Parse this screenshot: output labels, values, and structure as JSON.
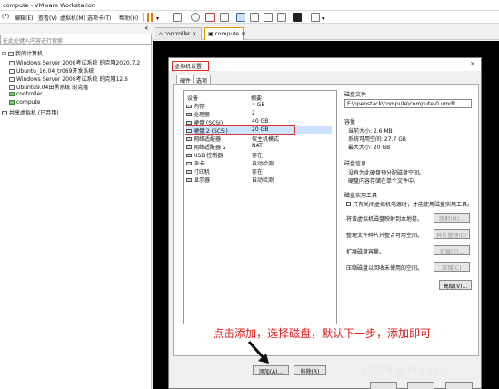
{
  "window": {
    "title": "compute - VMware Workstation"
  },
  "menu": [
    {
      "label": "(F)"
    },
    {
      "label": "编辑(E)"
    },
    {
      "label": "查看(V)"
    },
    {
      "label": "虚拟机(M)"
    },
    {
      "label": "选项卡(T)"
    },
    {
      "label": "帮助(H)"
    }
  ],
  "library": {
    "search_placeholder": "在此处键入内容进行搜索",
    "root": "我的计算机",
    "items": [
      {
        "label": "Windows Server 2008考试系统 的克隆2020.7.2"
      },
      {
        "label": "Ubuntu_16.04_tr069开发系统"
      },
      {
        "label": "Windows Server 2008考试系统 的克隆12.6"
      },
      {
        "label": "Ubuntu9.04田黑系统 的克隆"
      },
      {
        "label": "controller"
      },
      {
        "label": "compute"
      }
    ],
    "shared": "共享虚拟机 (已弃用)"
  },
  "tabs": [
    {
      "label": "controller"
    },
    {
      "label": "compute"
    }
  ],
  "dialog": {
    "title": "虚拟机设置",
    "tabs": [
      {
        "label": "硬件"
      },
      {
        "label": "选项"
      }
    ],
    "devlist_headers": {
      "device": "设备",
      "summary": "摘要"
    },
    "devices": [
      {
        "name": "内存",
        "summary": "4 GB"
      },
      {
        "name": "处理器",
        "summary": "2"
      },
      {
        "name": "硬盘 (SCSI)",
        "summary": "40 GB"
      },
      {
        "name": "硬盘 2 (SCSI)",
        "summary": "20 GB"
      },
      {
        "name": "网络适配器",
        "summary": "仅主机模式"
      },
      {
        "name": "网络适配器 2",
        "summary": "NAT"
      },
      {
        "name": "USB 控制器",
        "summary": "存在"
      },
      {
        "name": "声卡",
        "summary": "自动检测"
      },
      {
        "name": "打印机",
        "summary": "存在"
      },
      {
        "name": "显示器",
        "summary": "自动检测"
      }
    ],
    "add_button": "添加(A)...",
    "remove_button": "移除(R)",
    "disk_file": {
      "heading": "磁盘文件",
      "path": "F:\\openstack\\compute\\compute-0.vmdk"
    },
    "capacity": {
      "heading": "容量",
      "current_label": "当前大小: 2.6 MB",
      "free_label": "系统可用空间: 27.7 GB",
      "max_label": "最大大小: 20 GB"
    },
    "disk_info": {
      "heading": "磁盘信息",
      "line1": "没有为此硬盘预分配磁盘空间。",
      "line2": "硬盘内容存储在单个文件中。"
    },
    "disk_utility": {
      "heading": "磁盘实用工具",
      "note": "只有关闭虚拟机电源时，才能使用磁盘实用工具。",
      "map_label": "将该虚拟机磁盘映射到本地卷。",
      "map_button": "映射(M)...",
      "defrag_label": "整理文件碎片并整合可用空间。",
      "defrag_button": "碎片整理(D)",
      "expand_label": "扩展磁盘容量。",
      "expand_button": "扩展(E)...",
      "compact_label": "压缩磁盘以回收未使用的空间。",
      "compact_button": "压缩(C)"
    },
    "advanced_button": "高级(V)..."
  },
  "annotation": "点击添加，选择磁盘，默认下一步，添加即可",
  "watermark": "CSDN @kcyuan"
}
